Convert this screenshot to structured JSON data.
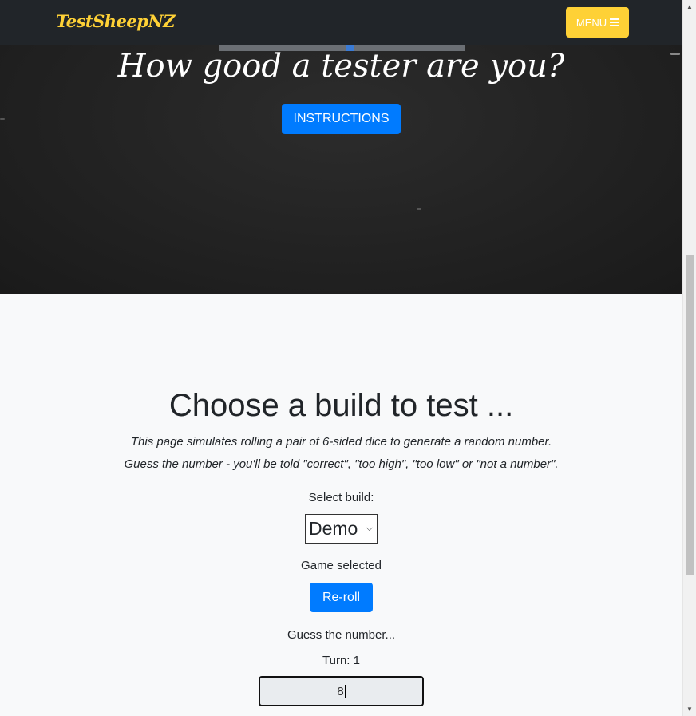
{
  "navbar": {
    "brand": "TestSheepNZ",
    "menu_label": "MENU",
    "menu_icon": "bars-icon",
    "brand_color": "#fed136"
  },
  "hero": {
    "title": "How good a tester are you?",
    "instructions_label": "INSTRUCTIONS"
  },
  "main": {
    "title": "Choose a build to test ...",
    "description_line1": "This page simulates rolling a pair of 6-sided dice to generate a random number.",
    "description_line2": "Guess the number - you'll be told \"correct\", \"too high\", \"too low\" or \"not a number\".",
    "select_label": "Select build:",
    "selected_build": "Demo",
    "game_status": "Game selected",
    "reroll_label": "Re-roll",
    "guess_prompt": "Guess the number...",
    "turn_text": "Turn: 1",
    "guess_value": "8"
  },
  "colors": {
    "primary": "#007bff",
    "accent": "#fed136",
    "navbar": "#212529"
  }
}
